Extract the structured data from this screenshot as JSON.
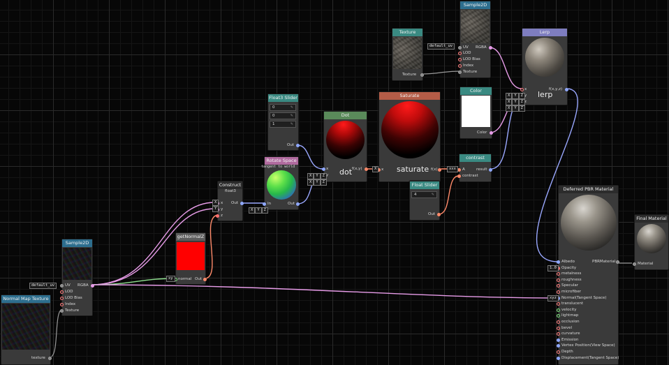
{
  "nodes": {
    "sample2d_top": {
      "title": "Sample2D",
      "uv": "UV",
      "rgba": "RGBA",
      "lod": "LOD",
      "lod_bias": "LOD Bias",
      "index": "Index",
      "texture": "Texture",
      "uv_badge": "default_uv"
    },
    "texture": {
      "title": "Texture",
      "out": "Texture"
    },
    "lerp": {
      "title": "Lerp",
      "func": "f(x,y,z)",
      "label": "lerp",
      "x": "x",
      "y": "y",
      "z": "z",
      "badge_xyz": [
        "X",
        "Y",
        "Z"
      ]
    },
    "color": {
      "title": "Color",
      "out": "Color"
    },
    "float3_slider": {
      "title": "Float3 Slider",
      "values": [
        "0",
        "0",
        "1"
      ],
      "out": "Out"
    },
    "dot": {
      "title": "Dot",
      "func": "f(x,y)",
      "label": "dot",
      "x": "x",
      "y": "y"
    },
    "saturate": {
      "title": "Saturate",
      "func": "f(x)",
      "label": "saturate",
      "x": "x"
    },
    "contrast": {
      "title": "contrast",
      "a": "A",
      "contrast": "contrast",
      "result": "result",
      "badge": "xxx"
    },
    "rotate_space": {
      "title": "Rotate Space",
      "subtitle": "tangent to world",
      "in": "In",
      "out": "Out"
    },
    "construct": {
      "title": "Construct",
      "subtitle": "float3",
      "x": "x",
      "y": "y",
      "z": "z",
      "out": "Out"
    },
    "float_slider": {
      "title": "Float Slider",
      "value": "4",
      "out": "Out"
    },
    "get_normal_z": {
      "title": "getNormalZ",
      "normal": "normal",
      "out": "Out",
      "badge": "xy"
    },
    "sample2d_bottom": {
      "title": "Sample2D",
      "uv": "UV",
      "rgba": "RGBA",
      "lod": "LOD",
      "lod_bias": "LOD Bias",
      "index": "Index",
      "texture": "Texture",
      "uv_badge": "default_uv"
    },
    "normal_map_texture": {
      "title": "Normal Map Texture",
      "out": "texture"
    },
    "deferred_pbr": {
      "title": "Deferred PBR Material",
      "out": "PBRMaterial",
      "opacity_badge": "1.0",
      "normal_badge": "xyz",
      "inputs": [
        "Albedo",
        "Opacity",
        "metalness",
        "roughness",
        "Specular",
        "microfiber",
        "Normal(Tangent Space)",
        "translucent",
        "velocity",
        "lightmap",
        "occlusion",
        "bevel",
        "curvature",
        "Emission",
        "Vertex Position(View Space)",
        "Depth",
        "Displacement(Tangent Space)"
      ]
    },
    "final_material": {
      "title": "Final Material",
      "in": "Material"
    }
  },
  "badges": {
    "swizzle_xyz": [
      "X",
      "Y",
      "Z"
    ],
    "swizzle_x": "X"
  },
  "colors": {
    "wire_pink": "#e79ce8",
    "wire_blue": "#9aa8ff",
    "wire_green": "#8fe08f",
    "wire_orange": "#ff8a6a",
    "wire_gray": "#9a9a9a",
    "lerp_header": "#7e7dbf",
    "saturate_header": "#b45c47",
    "rotate_header": "#b06a9e",
    "sample_header": "#2d6e8e",
    "teal_header": "#3a8a82"
  }
}
